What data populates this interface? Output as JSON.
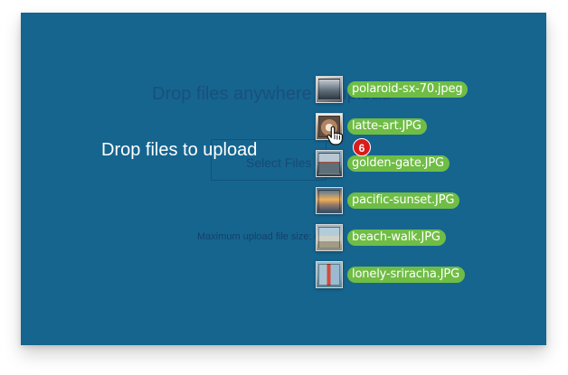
{
  "screen": {
    "drop_overlay": {
      "prompt": "Drop files to upload"
    },
    "background": {
      "title": "Drop files anywhere to upload",
      "select_button": "Select Files",
      "max_upload": "Maximum upload file size: 64 MB"
    }
  },
  "drag": {
    "count": "6",
    "files": [
      {
        "name": "polaroid-sx-70.jpeg",
        "icon": "photo-icon"
      },
      {
        "name": "latte-art.JPG",
        "icon": "photo-icon"
      },
      {
        "name": "golden-gate.JPG",
        "icon": "photo-icon"
      },
      {
        "name": "pacific-sunset.JPG",
        "icon": "photo-icon"
      },
      {
        "name": "beach-walk.JPG",
        "icon": "photo-icon"
      },
      {
        "name": "lonely-sriracha.JPG",
        "icon": "photo-icon"
      }
    ]
  },
  "colors": {
    "background": "#15658f",
    "pill": "#6fbd45",
    "badge": "#d81b1b"
  }
}
